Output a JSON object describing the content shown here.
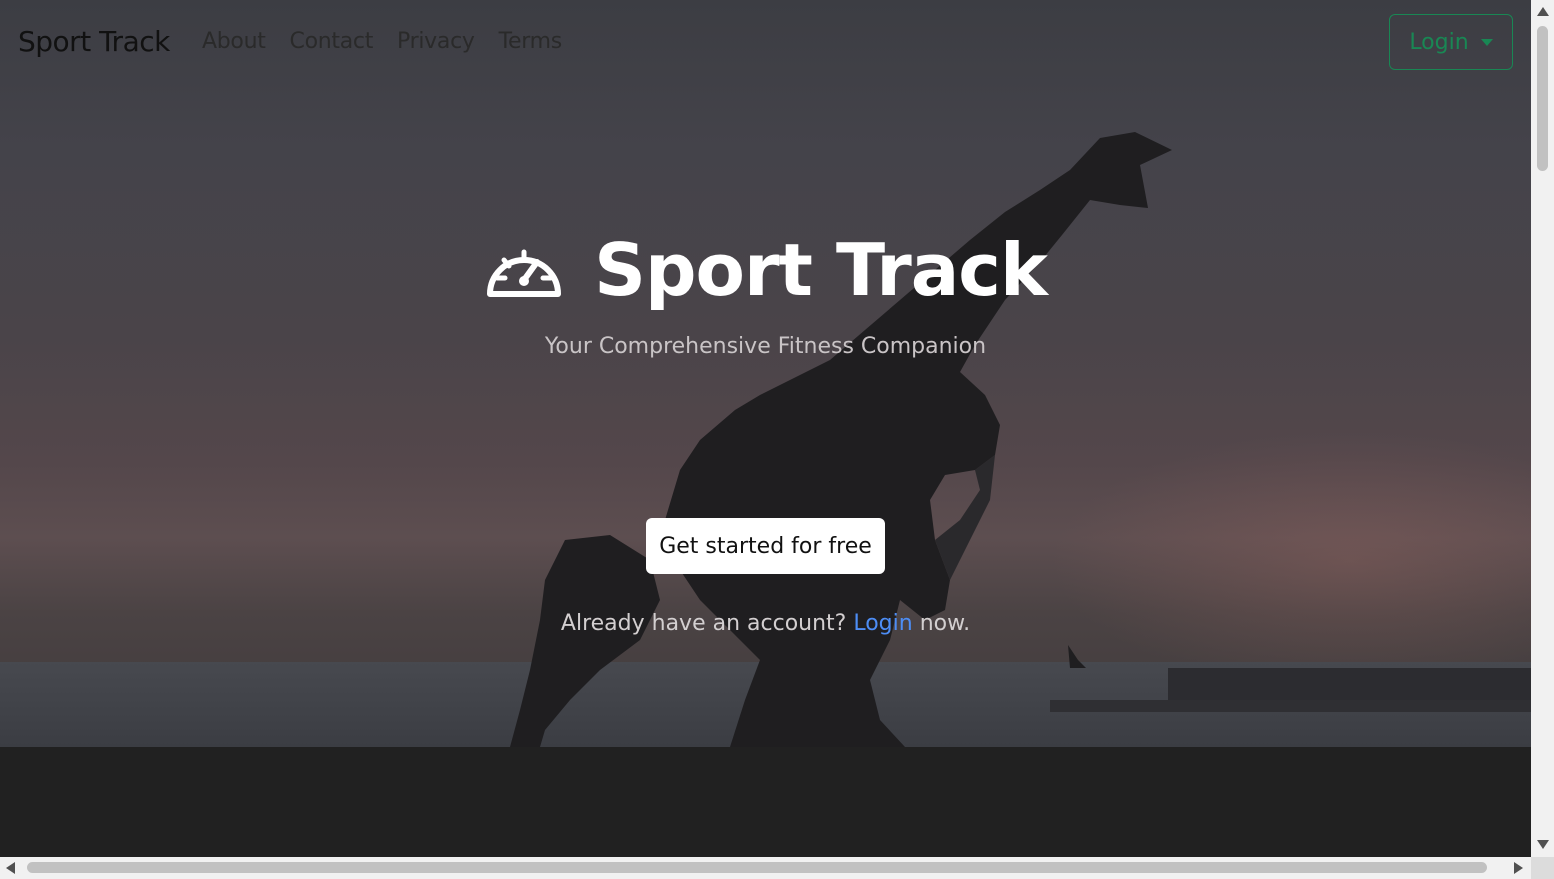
{
  "navbar": {
    "brand": "Sport Track",
    "links": [
      {
        "label": "About"
      },
      {
        "label": "Contact"
      },
      {
        "label": "Privacy"
      },
      {
        "label": "Terms"
      }
    ],
    "login_label": "Login"
  },
  "hero": {
    "icon": "speedometer-icon",
    "title": "Sport Track",
    "subtitle": "Your Comprehensive Fitness Companion",
    "cta_label": "Get started for free",
    "account_prefix": "Already have an account?",
    "account_link": "Login",
    "account_suffix": "now."
  },
  "colors": {
    "accent_green": "#198754",
    "link_blue": "#4d8df5",
    "page_dark": "#212121"
  }
}
